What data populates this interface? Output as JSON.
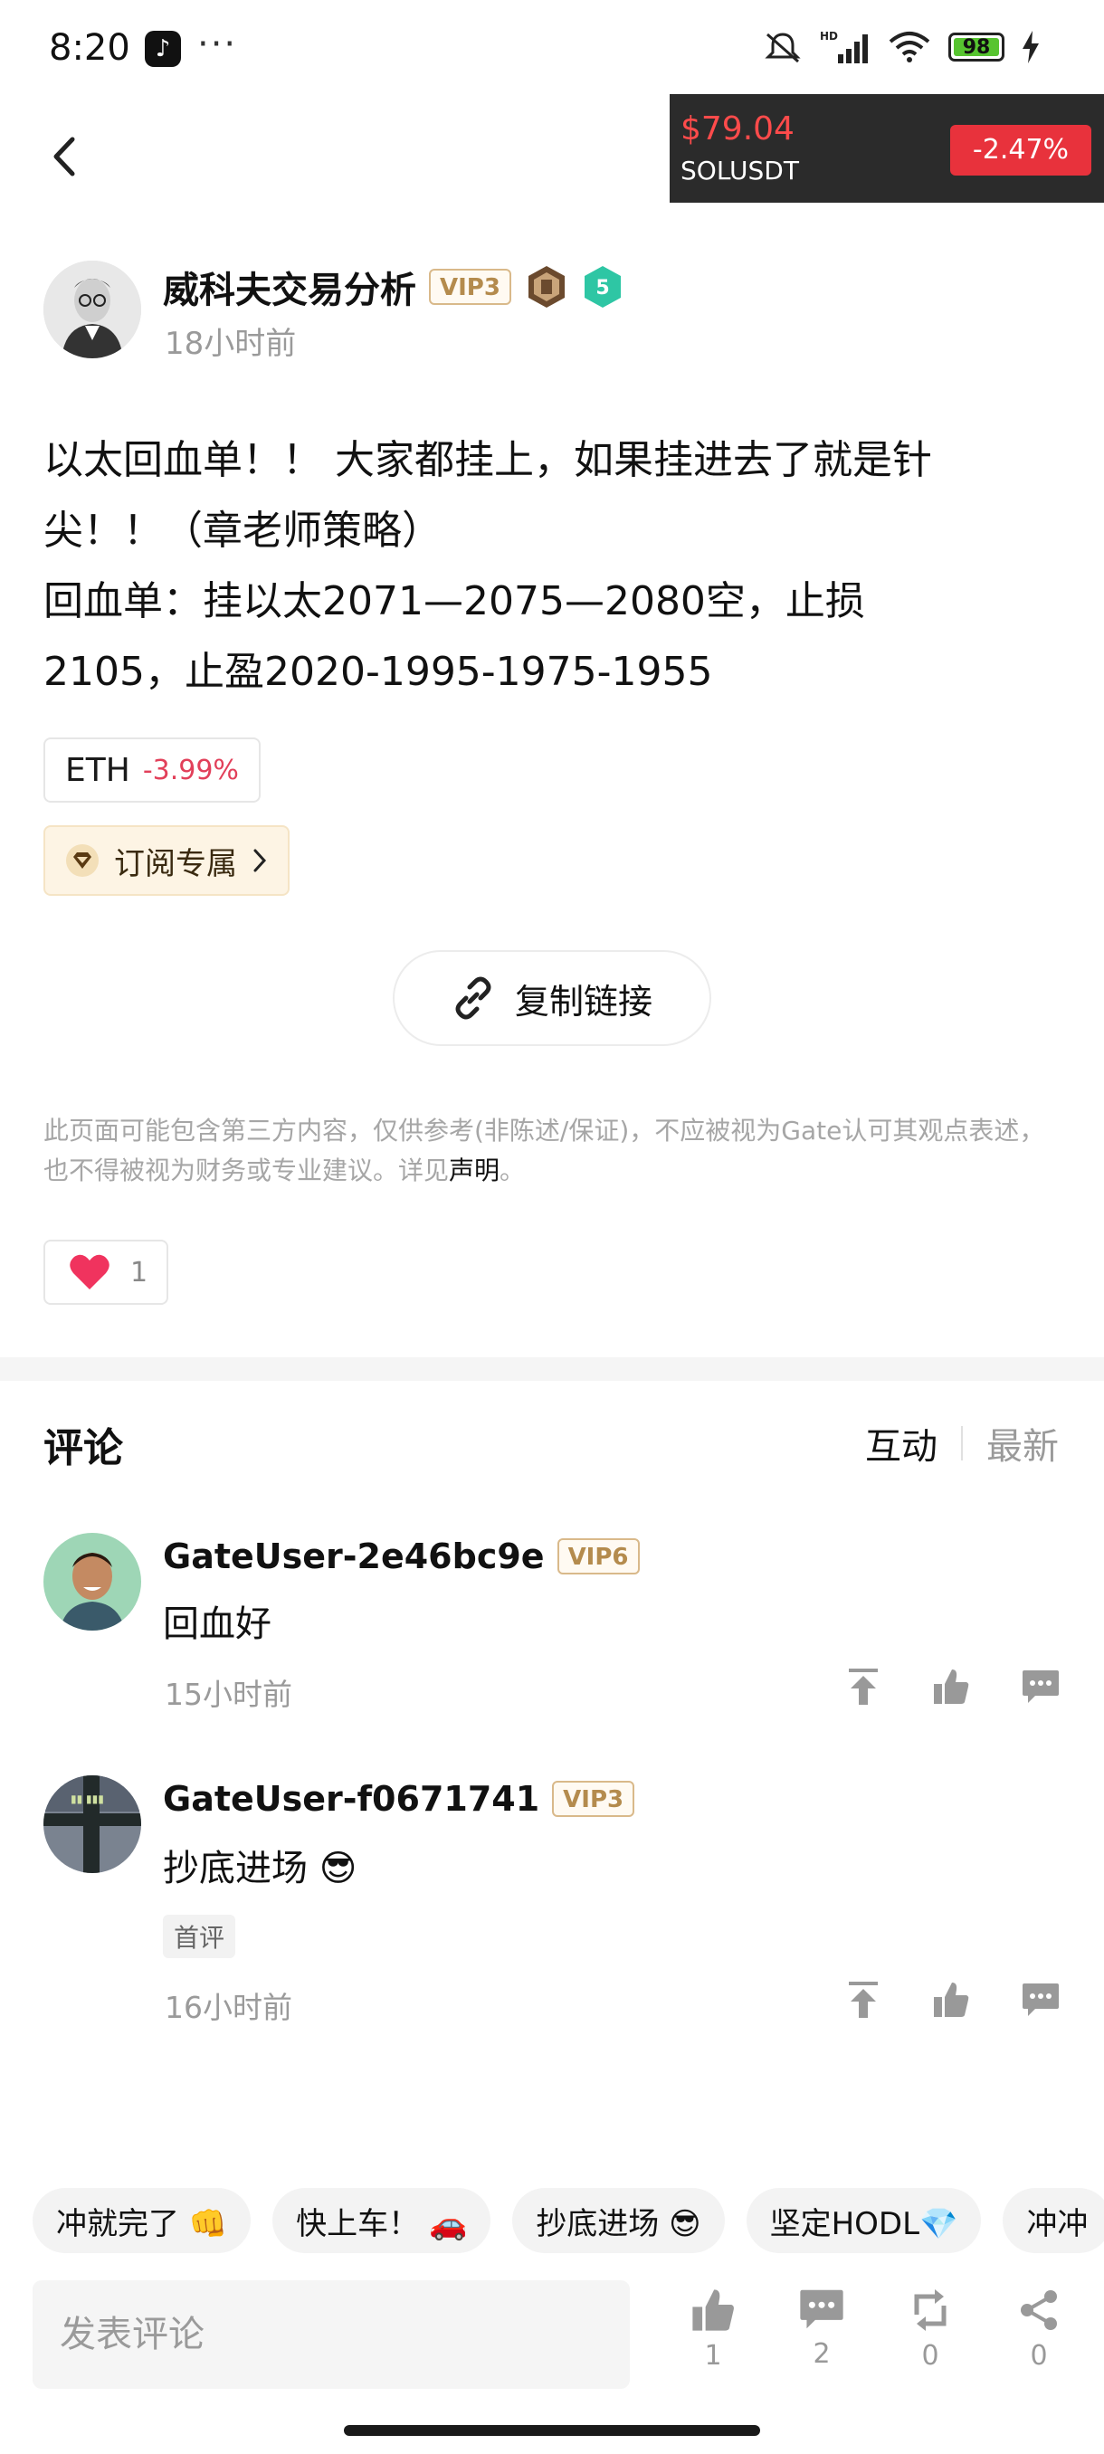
{
  "status_bar": {
    "time": "8:20",
    "app_icon": "tiktok-icon",
    "more": "···",
    "battery": "98"
  },
  "ticker": {
    "price": "$79.04",
    "symbol": "SOLUSDT",
    "change": "-2.47%"
  },
  "author": {
    "name": "威科夫交易分析",
    "vip": "VIP3",
    "level": "5",
    "time": "18小时前"
  },
  "post": {
    "lines": [
      "以太回血单！！ 大家都挂上，如果挂进去了就是针",
      "尖！！（章老师策略）",
      "回血单：挂以太2071—2075—2080空，止损",
      "2105，止盈2020-1995-1975-1955"
    ]
  },
  "eth_tag": {
    "symbol": "ETH",
    "change": "-3.99%"
  },
  "subscribe": {
    "label": "订阅专属"
  },
  "copy_link": {
    "label": "复制链接"
  },
  "disclaimer": {
    "text1": "此页面可能包含第三方内容，仅供参考(非陈述/保证)，不应被视为Gate认可其观点表述，也不得被视为财务或专业建议。详见",
    "link": "声明",
    "text2": "。"
  },
  "likes": {
    "count": "1"
  },
  "comments_section": {
    "title": "评论",
    "sort_active": "互动",
    "sort_other": "最新"
  },
  "comments": [
    {
      "user": "GateUser-2e46bc9e",
      "vip": "VIP6",
      "text": "回血好",
      "time": "15小时前"
    },
    {
      "user": "GateUser-f0671741",
      "vip": "VIP3",
      "text": "抄底进场 😎",
      "tag": "首评",
      "time": "16小时前"
    }
  ],
  "quick_replies": [
    "冲就完了 👊",
    "快上车！ 🚗",
    "抄底进场 😎",
    "坚定HODL💎",
    "冲冲"
  ],
  "bottom_bar": {
    "placeholder": "发表评论",
    "likes": "1",
    "comments": "2",
    "reposts": "0",
    "shares": "0"
  },
  "colors": {
    "accent_red": "#e8323c",
    "ticker_bg": "#2b2b2b",
    "vip_gold": "#b48b4d"
  }
}
